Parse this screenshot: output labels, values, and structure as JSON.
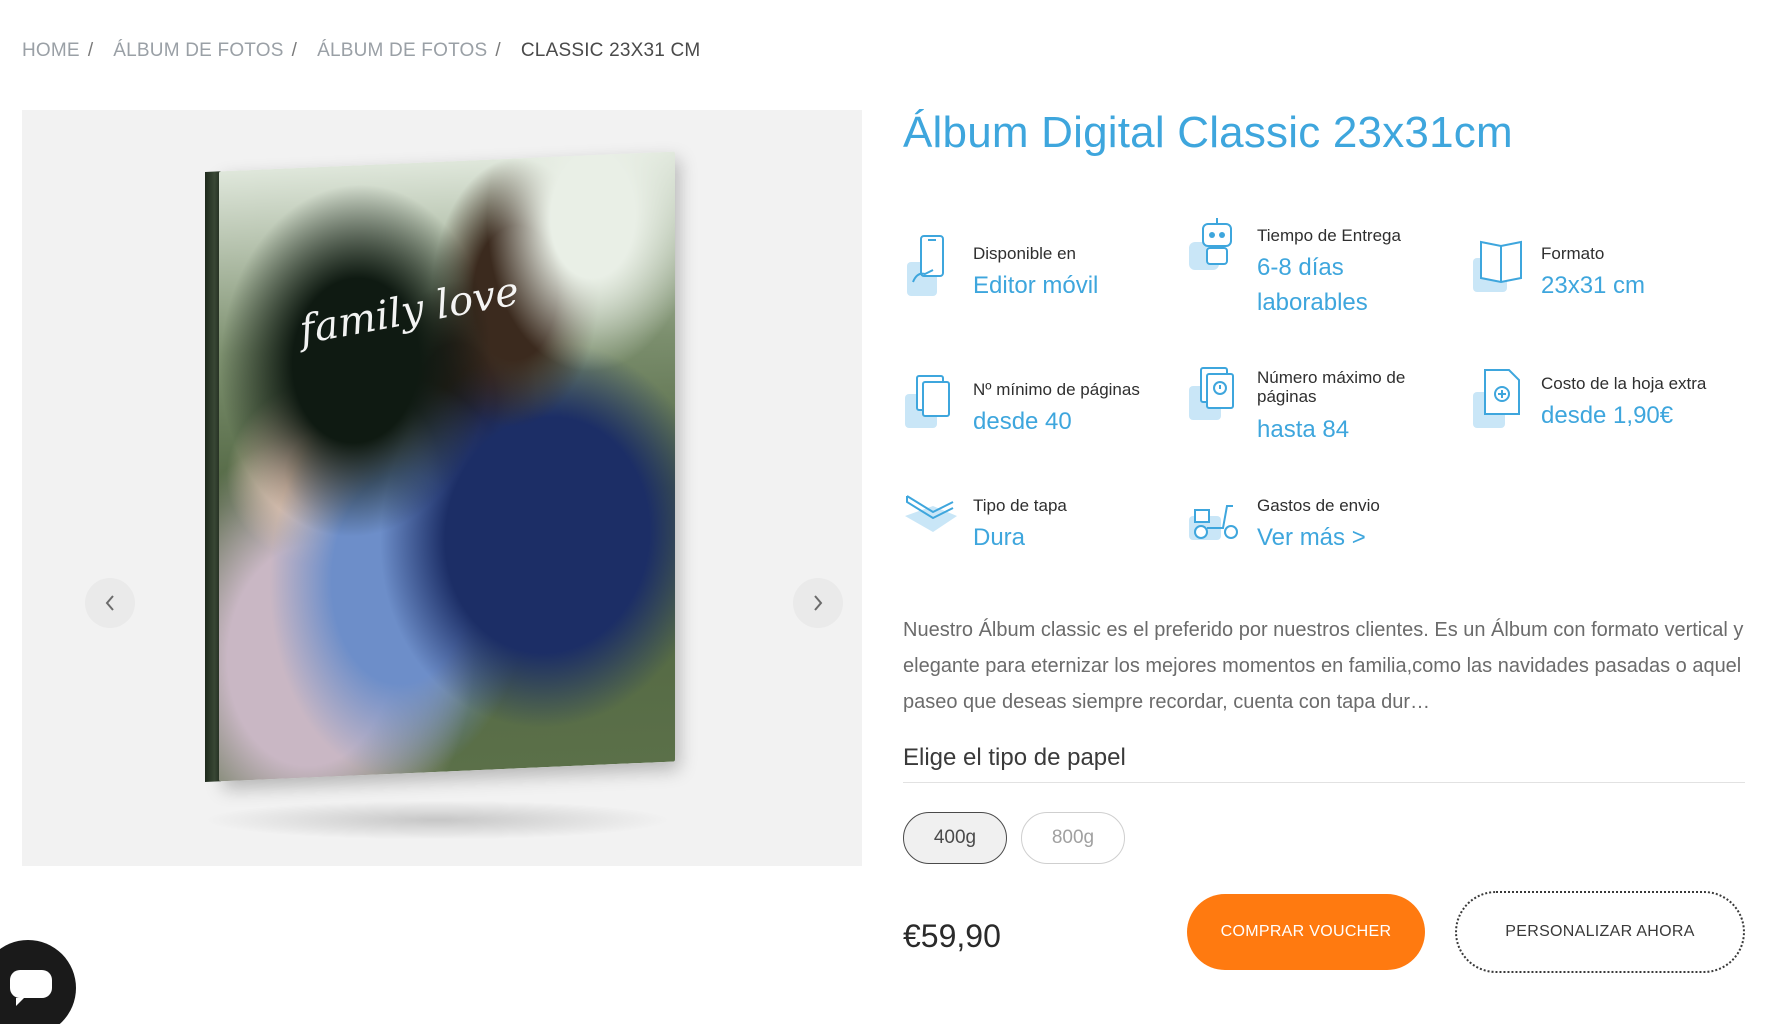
{
  "breadcrumb": [
    {
      "label": "HOME"
    },
    {
      "label": "ÁLBUM DE FOTOS"
    },
    {
      "label": "ÁLBUM DE FOTOS"
    },
    {
      "label": "CLASSIC 23X31 CM"
    }
  ],
  "gallery": {
    "cover_text": "family love",
    "prev_icon": "chevron-left-icon",
    "next_icon": "chevron-right-icon"
  },
  "product": {
    "title": "Álbum Digital Classic 23x31cm",
    "features": [
      {
        "label": "Disponible en",
        "value": "Editor móvil",
        "icon": "mobile-phone-icon"
      },
      {
        "label": "Tiempo de Entrega",
        "value": "6-8 días laborables",
        "icon": "robot-icon"
      },
      {
        "label": "Formato",
        "value": "23x31 cm",
        "icon": "open-book-icon"
      },
      {
        "label": "Nº mínimo de páginas",
        "value": "desde 40",
        "icon": "pages-stack-icon"
      },
      {
        "label": "Número máximo de páginas",
        "value": "hasta 84",
        "icon": "pages-info-icon"
      },
      {
        "label": "Costo de la hoja extra",
        "value": "desde 1,90€",
        "icon": "add-page-icon"
      },
      {
        "label": "Tipo de tapa",
        "value": "Dura",
        "icon": "hardcover-icon"
      },
      {
        "label": "Gastos de envio",
        "value": "Ver más >",
        "icon": "scooter-icon"
      }
    ],
    "description": "Nuestro Álbum classic es el preferido por nuestros clientes. Es un Álbum con formato vertical y elegante para eternizar los mejores momentos en familia,como las navidades pasadas o aquel paseo que deseas siempre recordar, cuenta con tapa dur…",
    "paper": {
      "title": "Elige el tipo de papel",
      "options": [
        "400g",
        "800g"
      ],
      "selected": "400g"
    },
    "price": "€59,90",
    "buy_voucher_label": "COMPRAR VOUCHER",
    "personalize_label": "PERSONALIZAR AHORA"
  },
  "chat": {
    "icon": "chat-bubble-icon"
  },
  "colors": {
    "accent_blue": "#3ea6dd",
    "icon_light_blue": "#c9e6f7",
    "orange": "#ff7a10"
  }
}
